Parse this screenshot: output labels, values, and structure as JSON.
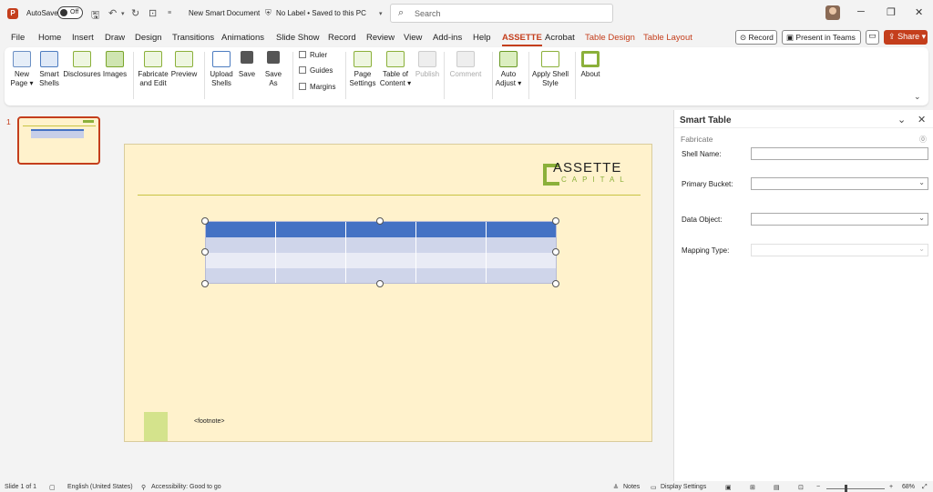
{
  "titlebar": {
    "autosave_label": "AutoSave",
    "autosave_state": "Off",
    "doc_title": "New Smart Document",
    "doc_status": "No Label • Saved to this PC",
    "search_placeholder": "Search"
  },
  "menu": {
    "tabs": [
      "File",
      "Home",
      "Insert",
      "Draw",
      "Design",
      "Transitions",
      "Animations",
      "Slide Show",
      "Record",
      "Review",
      "View",
      "Add-ins",
      "Help",
      "ASSETTE",
      "Acrobat",
      "Table Design",
      "Table Layout"
    ],
    "active": "ASSETTE",
    "record": "Record",
    "present_teams": "Present in Teams",
    "share": "Share"
  },
  "ribbon": {
    "new_page": "New Page",
    "smart_shells": "Smart Shells",
    "disclosures": "Disclosures",
    "images": "Images",
    "fabricate_edit": "Fabricate and Edit",
    "preview": "Preview",
    "upload_shells": "Upload Shells",
    "save": "Save",
    "save_as": "Save As",
    "ruler": "Ruler",
    "guides": "Guides",
    "margins": "Margins",
    "page_settings": "Page Settings",
    "table_of_content": "Table of Content",
    "publish": "Publish",
    "comment": "Comment",
    "auto_adjust": "Auto Adjust",
    "apply_shell_style": "Apply Shell Style",
    "about": "About"
  },
  "thumbnail": {
    "number": "1"
  },
  "slide": {
    "logo_word": "ASSETTE",
    "logo_sub": "CAPITAL",
    "footnote": "<footnote>"
  },
  "pane": {
    "title": "Smart Table",
    "section": "Fabricate",
    "shell_name_label": "Shell Name:",
    "primary_bucket_label": "Primary Bucket:",
    "data_object_label": "Data Object:",
    "mapping_type_label": "Mapping Type:"
  },
  "status": {
    "slide": "Slide 1 of 1",
    "language": "English (United States)",
    "accessibility": "Accessibility: Good to go",
    "notes": "Notes",
    "display_settings": "Display Settings",
    "zoom": "68%"
  },
  "colors": {
    "accent": "#c43e1c",
    "slide_bg": "#fff2cc",
    "table_header": "#4472c4",
    "logo_green": "#8bb03a"
  }
}
